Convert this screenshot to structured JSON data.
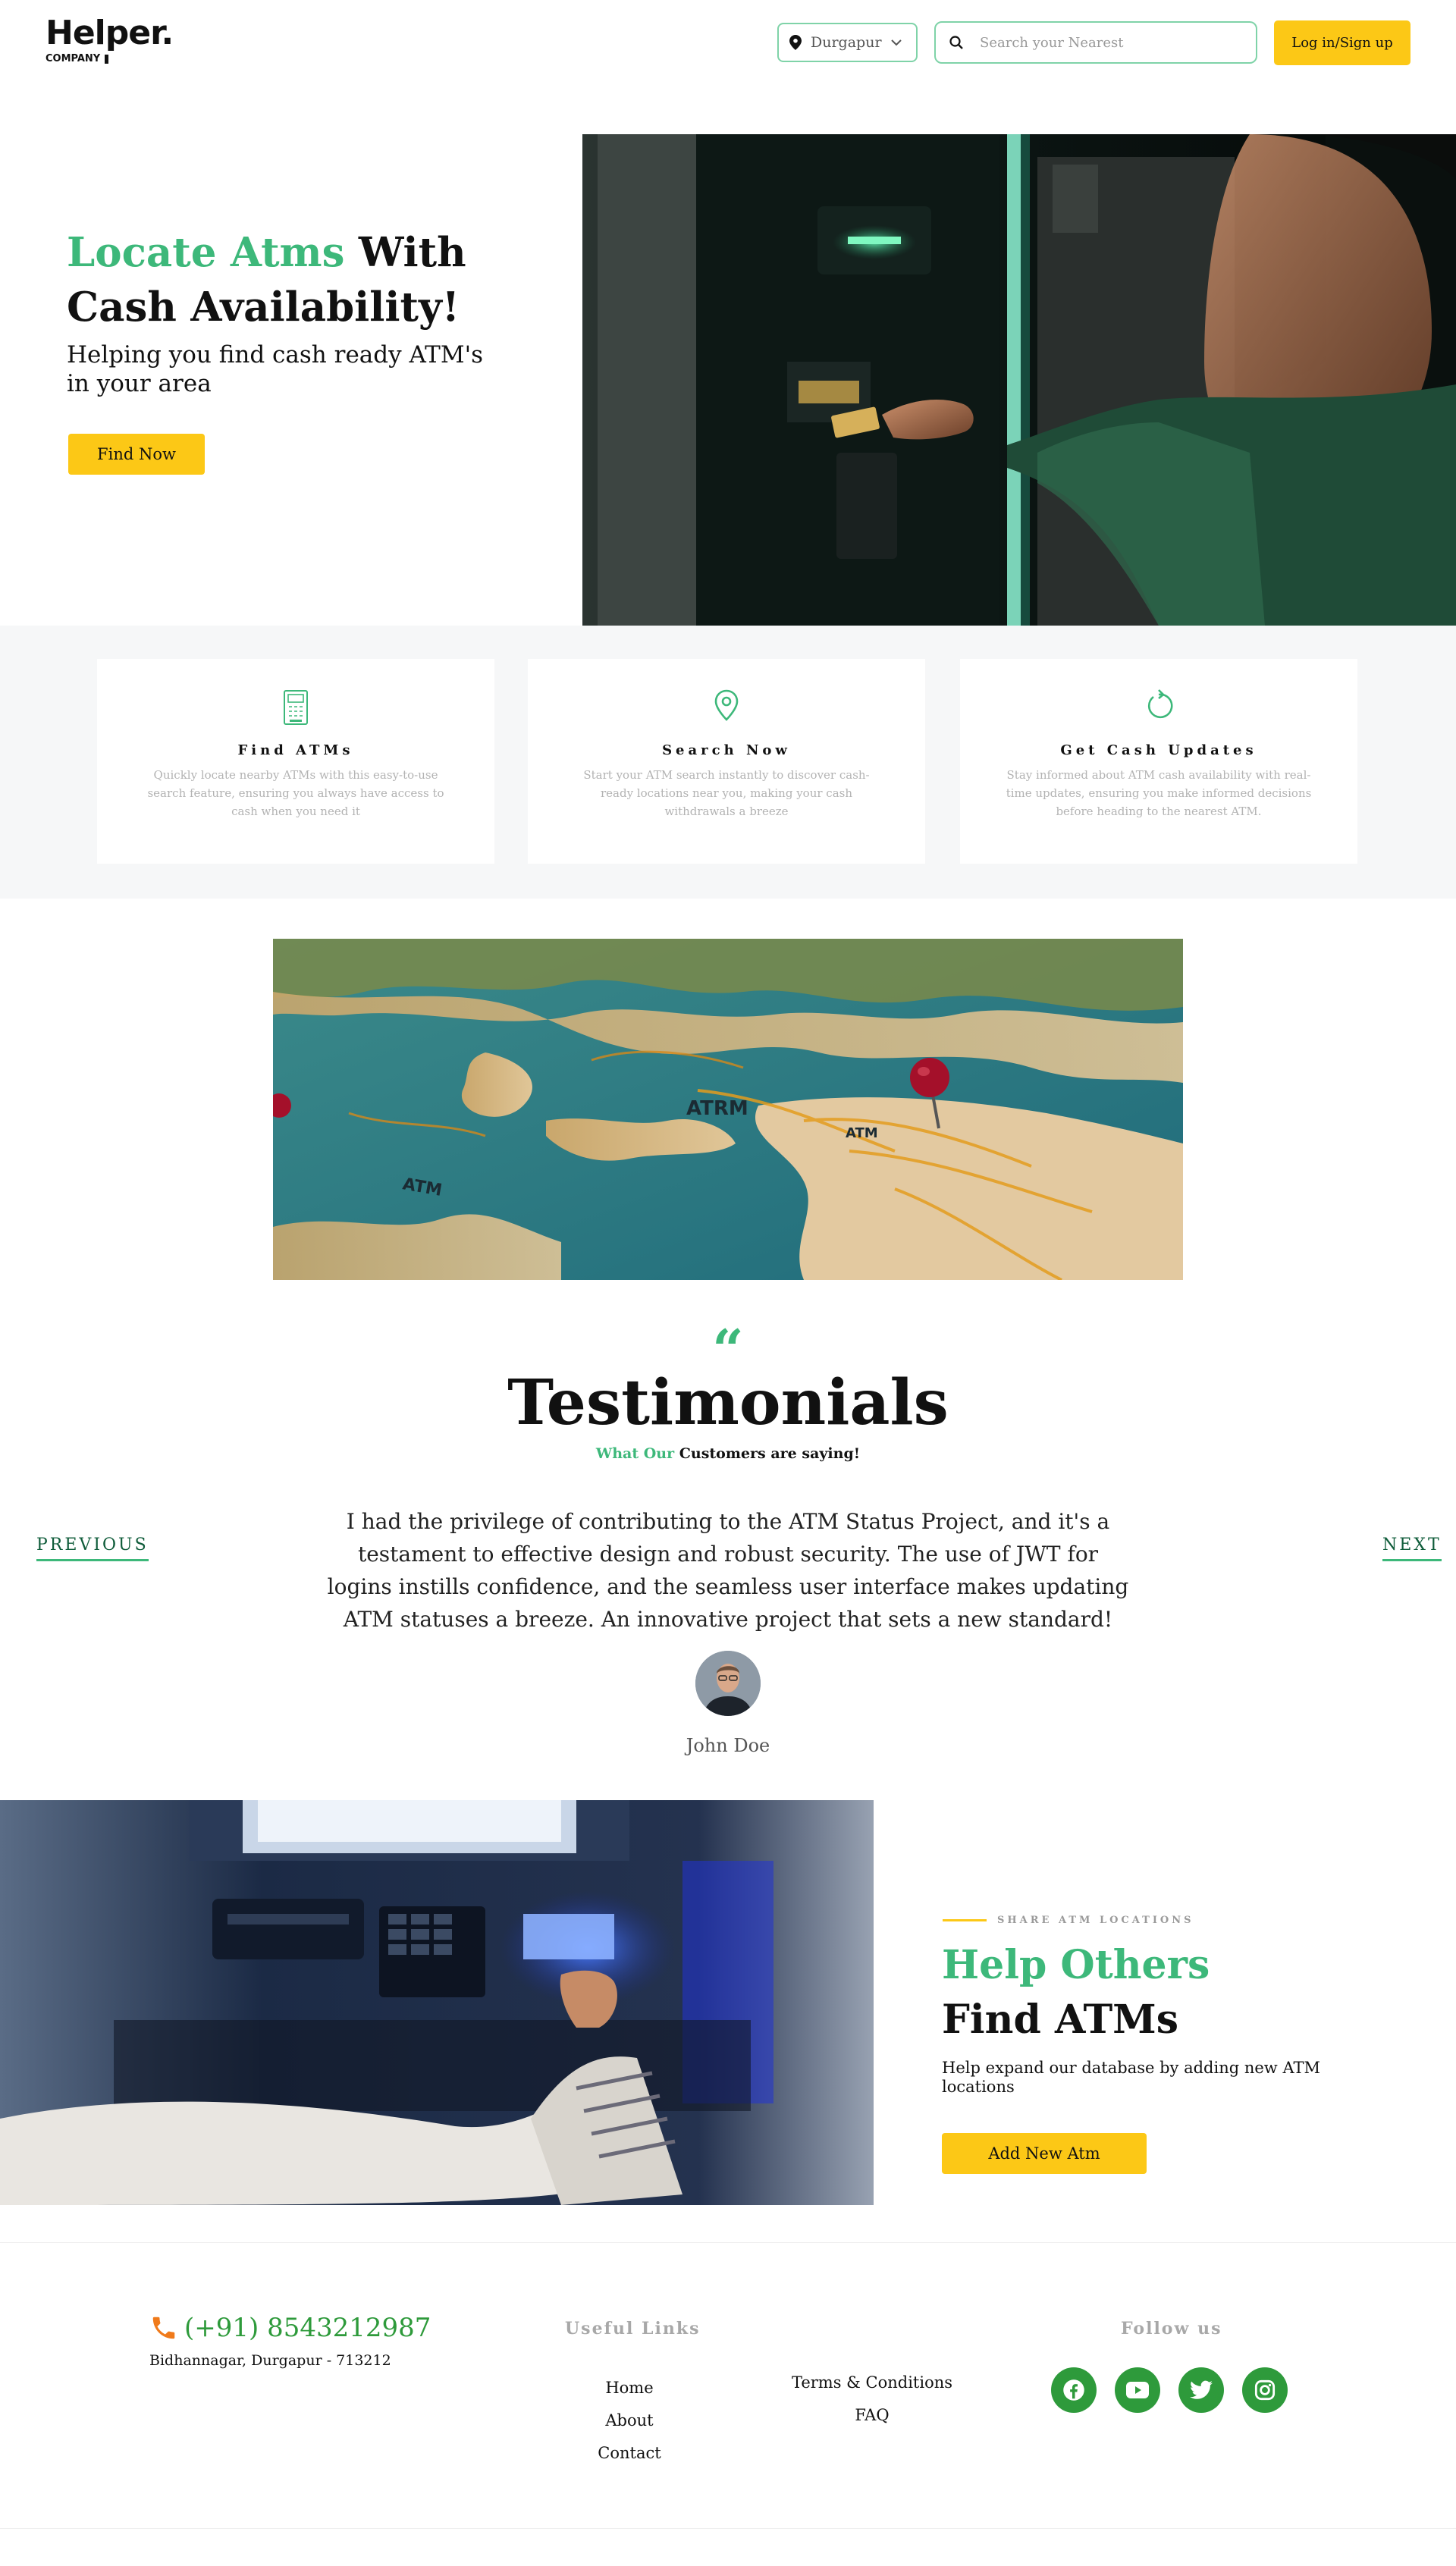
{
  "header": {
    "logo_text": "Helper.",
    "logo_sub": "COMPANY",
    "location_value": "Durgapur",
    "search_placeholder": "Search your Nearest",
    "login_label": "Log in/Sign up"
  },
  "hero": {
    "title_accent": "Locate Atms",
    "title_rest_1": " With",
    "title_rest_2": "Cash Availability!",
    "subtitle": "Helping you find cash ready ATM's in your area",
    "cta_label": "Find Now"
  },
  "features": [
    {
      "icon": "atm-machine-icon",
      "title": "Find ATMs",
      "desc": "Quickly locate nearby ATMs with this easy-to-use search feature, ensuring you always have access to cash when you need it"
    },
    {
      "icon": "map-pin-icon",
      "title": "Search Now",
      "desc": "Start your ATM search instantly to discover cash-ready locations near you, making your cash withdrawals a breeze"
    },
    {
      "icon": "refresh-icon",
      "title": "Get Cash Updates",
      "desc": "Stay informed about ATM cash availability with real-time updates, ensuring you make informed decisions before heading to the nearest ATM."
    }
  ],
  "map_labels": {
    "label_1": "ATRM",
    "label_2": "ATM",
    "label_3": "ATM"
  },
  "testimonials": {
    "quote_glyph": "“",
    "title": "Testimonials",
    "sub_accent": "What Our",
    "sub_rest": " Customers are saying!",
    "prev_label": "PREVIOUS",
    "next_label": "NEXT",
    "text": "I had the privilege of contributing to the ATM Status Project, and it's a testament to effective design and robust security. The use of JWT for logins instills confidence, and the seamless user interface makes updating ATM statuses a breeze. An innovative project that sets a new standard!",
    "name": "John Doe"
  },
  "add_atm": {
    "eyebrow": "SHARE ATM LOCATIONS",
    "title_accent": "Help Others",
    "title_rest": "Find ATMs",
    "desc": "Help expand our database by adding new ATM locations",
    "cta_label": "Add New Atm"
  },
  "footer": {
    "phone": "(+91) 8543212987",
    "address": "Bidhannagar, Durgapur - 713212",
    "useful_links_title": "Useful Links",
    "links_col1": [
      "Home",
      "About",
      "Contact"
    ],
    "links_col2": [
      "Terms & Conditions",
      "FAQ"
    ],
    "follow_title": "Follow us",
    "socials": [
      "facebook-icon",
      "youtube-icon",
      "twitter-icon",
      "instagram-icon"
    ]
  },
  "colors": {
    "accent_green": "#3db87a",
    "button_yellow": "#fcc816",
    "social_green": "#2e9a3b",
    "phone_orange": "#f07a1a"
  }
}
